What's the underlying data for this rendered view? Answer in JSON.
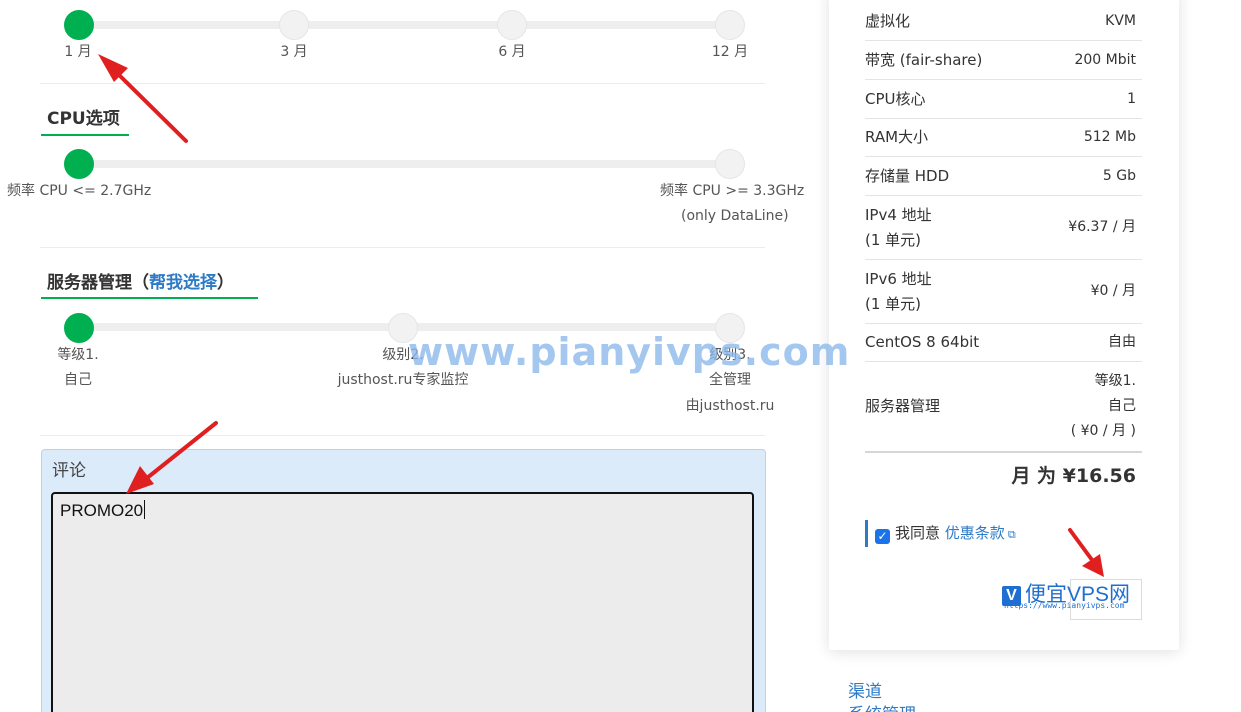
{
  "period": {
    "options": [
      "1 月",
      "3 月",
      "6 月",
      "12 月"
    ],
    "selected_index": 0
  },
  "cpu": {
    "title": "CPU选项",
    "options": [
      "频率 CPU <= 2.7GHz",
      "频率 CPU >= 3.3GHz",
      "(only DataLine)"
    ],
    "selected_index": 0
  },
  "management": {
    "title": "服务器管理",
    "title_open": "（",
    "help_link": "帮我选择",
    "title_close": "）",
    "options": [
      {
        "line1": "等级1.",
        "line2": "自己",
        "line3": ""
      },
      {
        "line1": "级别2.",
        "line2": "justhost.ru专家监控",
        "line3": ""
      },
      {
        "line1": "级别3.",
        "line2": "全管理",
        "line3": "由justhost.ru"
      }
    ],
    "selected_index": 0
  },
  "comment": {
    "label": "评论",
    "value": "PROMO20"
  },
  "summary": {
    "rows": [
      {
        "key": "虚拟化",
        "value": "KVM"
      },
      {
        "key": "带宽 (fair-share)",
        "value": "200 Mbit"
      },
      {
        "key": "CPU核心",
        "value": "1"
      },
      {
        "key": "RAM大小",
        "value": "512 Mb"
      },
      {
        "key": "存储量 HDD",
        "value": "5 Gb"
      },
      {
        "key": "IPv4 地址",
        "key2": "(1 单元)",
        "value": "¥6.37 / 月"
      },
      {
        "key": "IPv6 地址",
        "key2": "(1 单元)",
        "value": "¥0 / 月"
      },
      {
        "key": "CentOS 8 64bit",
        "value": "自由"
      }
    ],
    "management_row": {
      "key": "服务器管理",
      "value_line1": "等级1.",
      "value_line2": "自己",
      "value_line3": "( ¥0 / 月 )"
    },
    "total": "月 为 ¥16.56",
    "agree_text": "我同意",
    "agree_link": "优惠条款",
    "agree_checked": true
  },
  "sidebar_links": [
    "渠道",
    "系统管理"
  ],
  "watermark": {
    "site": "www.pianyivps.com",
    "logo_letter": "V",
    "logo_text": "便宜VPS网",
    "logo_url": "https://www.pianyivps.com"
  },
  "colors": {
    "accent_green": "#00b050",
    "link_blue": "#2d7bc7",
    "arrow_red": "#e02020"
  }
}
